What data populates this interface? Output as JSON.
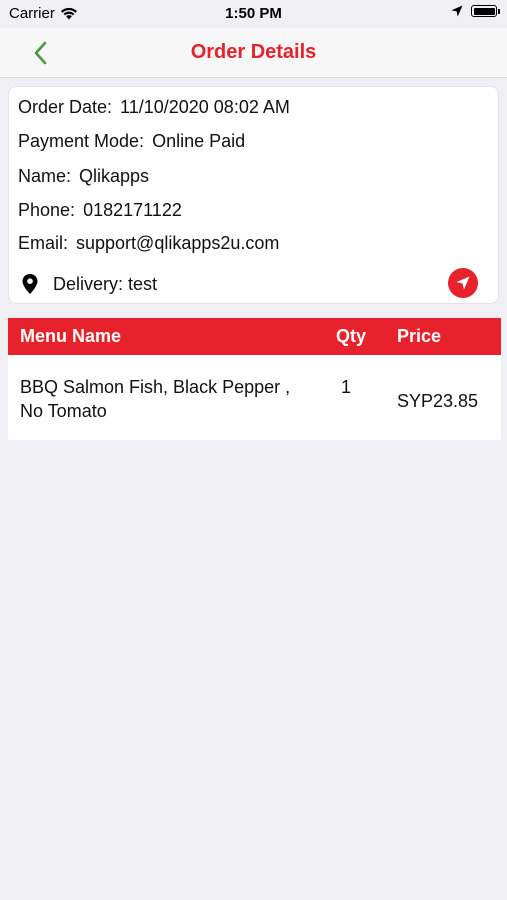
{
  "status_bar": {
    "carrier": "Carrier",
    "time": "1:50 PM"
  },
  "nav": {
    "title": "Order Details"
  },
  "order": {
    "date_label": "Order Date:",
    "date_value": "11/10/2020 08:02 AM",
    "payment_label": "Payment Mode:",
    "payment_value": "Online Paid",
    "name_label": "Name:",
    "name_value": "Qlikapps",
    "phone_label": "Phone:",
    "phone_value": "0182171122",
    "email_label": "Email:",
    "email_value": "support@qlikapps2u.com",
    "delivery_text": "Delivery: test"
  },
  "table": {
    "headers": {
      "menu_name": "Menu Name",
      "qty": "Qty",
      "price": "Price"
    },
    "rows": [
      {
        "menu_line1": "BBQ Salmon Fish, Black Pepper ,",
        "menu_line2": "No Tomato",
        "qty": "1",
        "price": "SYP23.85"
      }
    ]
  },
  "colors": {
    "accent": "#e8222c",
    "back_arrow": "#4a9a3b",
    "background": "#efeff4"
  },
  "icons": {
    "back": "chevron-left-icon",
    "location": "location-pin-icon",
    "navigate": "navigation-arrow-icon",
    "wifi": "wifi-icon",
    "gps": "location-arrow-icon",
    "battery": "battery-icon"
  }
}
